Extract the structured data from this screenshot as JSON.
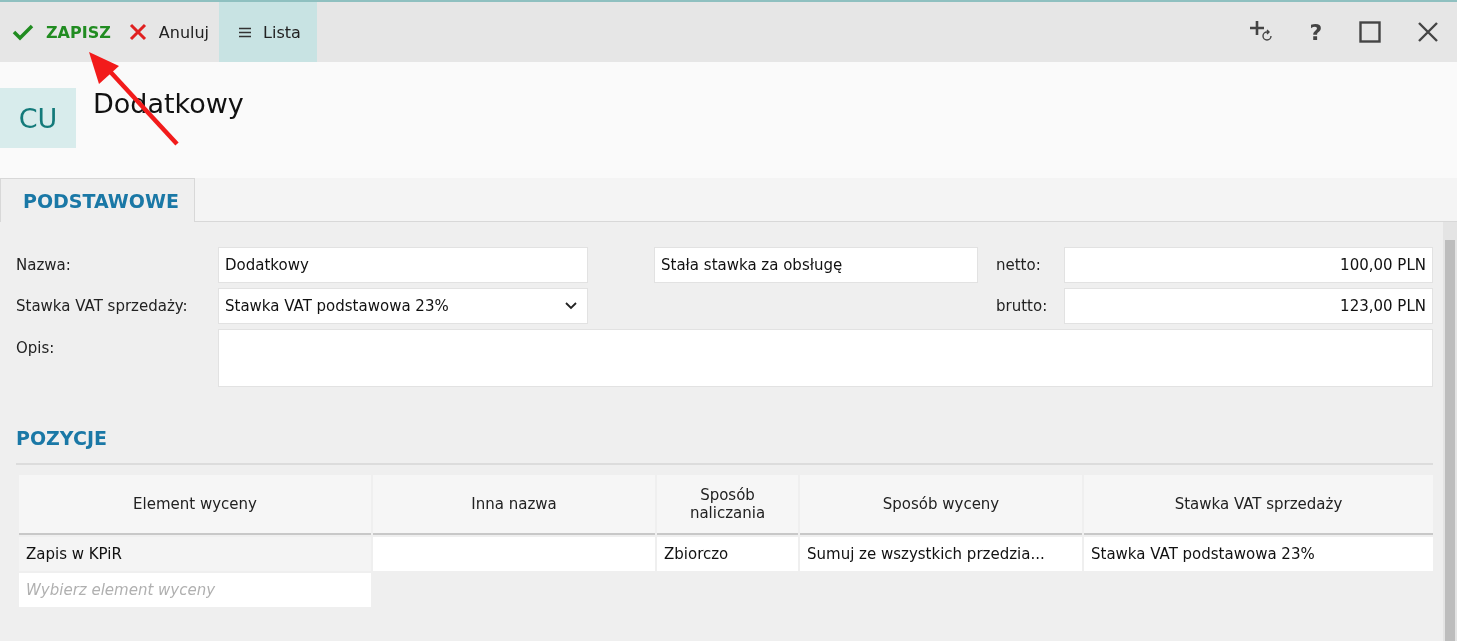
{
  "toolbar": {
    "buttons": [
      {
        "kind": "save",
        "label": "ZAPISZ",
        "selected": false
      },
      {
        "kind": "cancel",
        "label": "Anuluj",
        "selected": false
      },
      {
        "kind": "list",
        "label": "Lista",
        "selected": true
      }
    ],
    "window_controls": [
      {
        "kind": "add-related"
      },
      {
        "kind": "help",
        "label": "?"
      },
      {
        "kind": "maximize"
      },
      {
        "kind": "close"
      }
    ]
  },
  "header": {
    "badge": "CU",
    "title": "Dodatkowy"
  },
  "tabs": [
    {
      "label": "PODSTAWOWE",
      "selected": true
    }
  ],
  "form": {
    "name_label": "Nazwa:",
    "name_value": "Dodatkowy",
    "pricing_value": "Stała stawka za obsługę",
    "net_label": "netto:",
    "net_value": "100,00 PLN",
    "vat_label": "Stawka VAT sprzedaży:",
    "vat_value": "Stawka VAT podstawowa 23%",
    "gross_label": "brutto:",
    "gross_value": "123,00 PLN",
    "description_label": "Opis:"
  },
  "positions": {
    "title": "POZYCJE",
    "columns": [
      "Element wyceny",
      "Inna nazwa",
      "Sposób naliczania",
      "Sposób wyceny",
      "Stawka VAT sprzedaży"
    ],
    "rows": [
      [
        "Zapis w KPiR",
        "",
        "Zbiorczo",
        "Sumuj ze wszystkich przedzia...",
        "Stawka VAT podstawowa 23%"
      ]
    ],
    "new_row_placeholder": "Wybierz element wyceny"
  }
}
